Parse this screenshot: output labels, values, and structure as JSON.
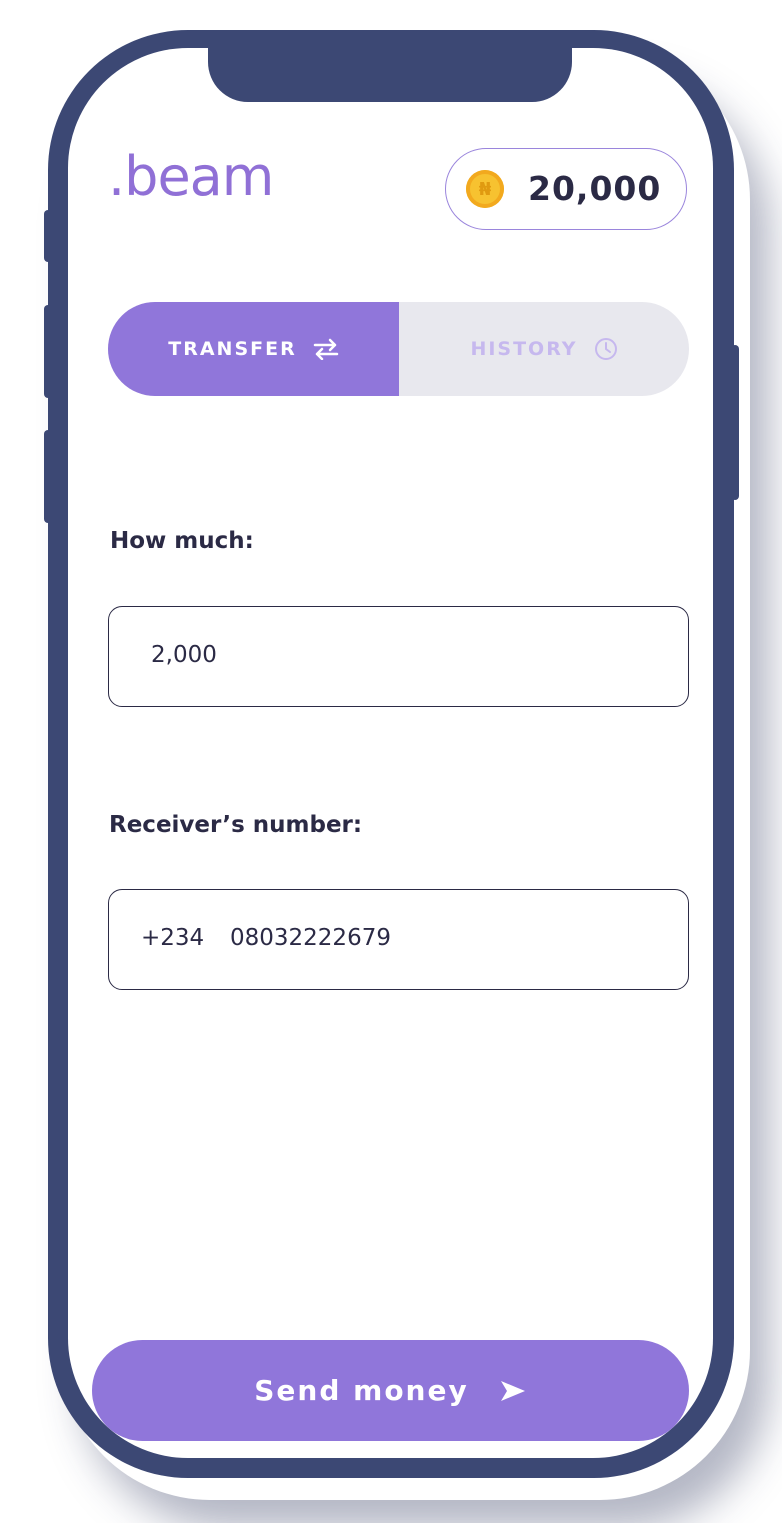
{
  "app": {
    "logo": ".beam",
    "balance": "20,000",
    "currency_symbol": "₦"
  },
  "tabs": [
    {
      "label": "TRANSFER",
      "icon": "transfer-arrows-icon",
      "active": true
    },
    {
      "label": "HISTORY",
      "icon": "clock-icon",
      "active": false
    }
  ],
  "form": {
    "amount_label": "How much:",
    "amount_value": "2,000",
    "receiver_label": "Receiver’s  number:",
    "country_code": "+234",
    "phone_value": "08032222679"
  },
  "actions": {
    "send_label": "Send money",
    "send_icon": "send-arrow-icon"
  },
  "colors": {
    "accent": "#9076da",
    "frame": "#3c4874",
    "text": "#2b2a45",
    "coin": "#f7c230"
  }
}
